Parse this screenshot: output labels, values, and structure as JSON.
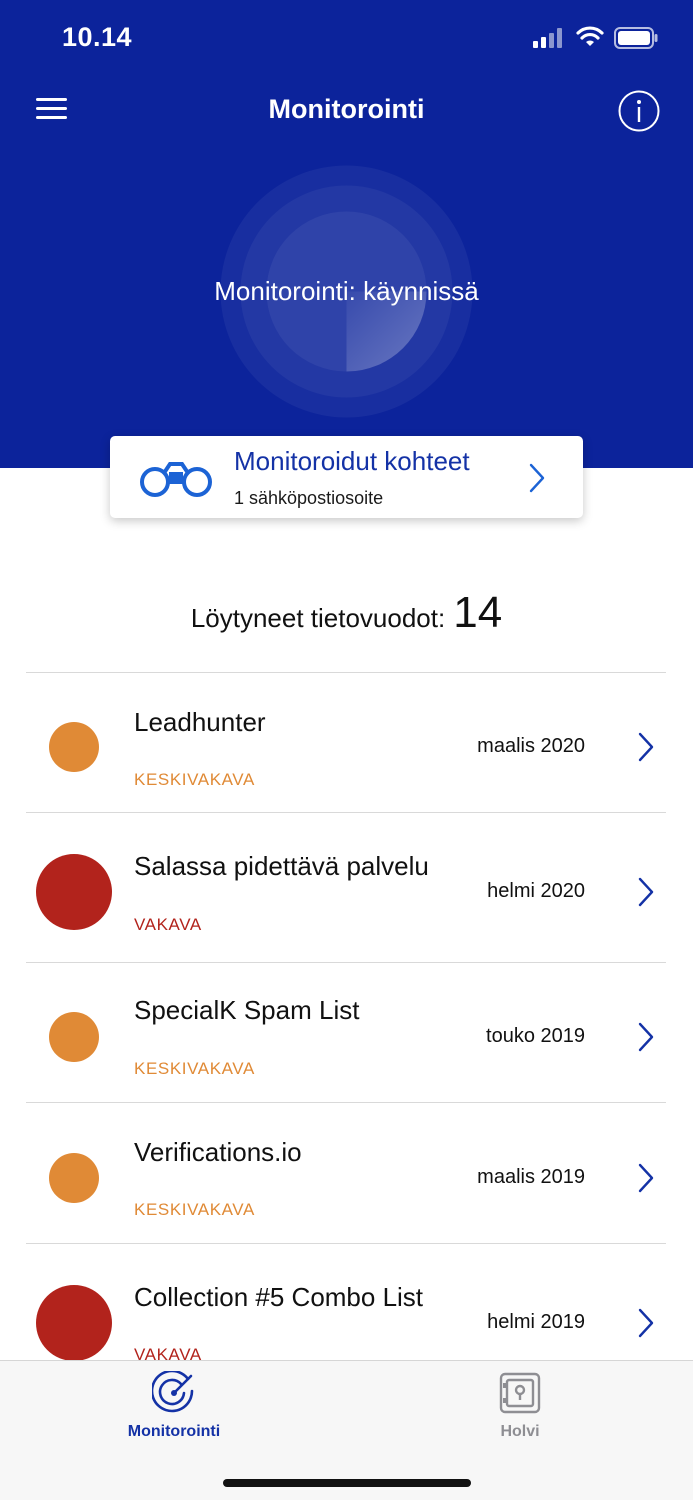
{
  "status_bar": {
    "time": "10.14"
  },
  "nav": {
    "title": "Monitorointi"
  },
  "hero": {
    "status_text": "Monitorointi: käynnissä"
  },
  "monitored": {
    "title": "Monitoroidut kohteet",
    "subtitle": "1 sähköpostiosoite"
  },
  "breaches": {
    "label": "Löytyneet tietovuodot:",
    "count": "14",
    "items": [
      {
        "name": "Leadhunter",
        "severity": "KESKIVAKAVA",
        "date": "maalis 2020",
        "severity_color": "#e08a36"
      },
      {
        "name": "Salassa pidettävä palvelu",
        "severity": "VAKAVA",
        "date": "helmi 2020",
        "severity_color": "#b2231c"
      },
      {
        "name": "SpecialK Spam List",
        "severity": "KESKIVAKAVA",
        "date": "touko 2019",
        "severity_color": "#e08a36"
      },
      {
        "name": "Verifications.io",
        "severity": "KESKIVAKAVA",
        "date": "maalis 2019",
        "severity_color": "#e08a36"
      },
      {
        "name": "Collection #5 Combo List",
        "severity": "VAKAVA",
        "date": "helmi 2019",
        "severity_color": "#b2231c"
      }
    ]
  },
  "tabs": [
    {
      "label": "Monitorointi",
      "icon": "radar-icon",
      "active": true,
      "color": "#1432a6"
    },
    {
      "label": "Holvi",
      "icon": "vault-icon",
      "active": false,
      "color": "#8e8e93"
    }
  ],
  "colors": {
    "brand": "#0c239b",
    "accent": "#1432a6",
    "medium": "#e08a36",
    "severe": "#b2231c"
  }
}
